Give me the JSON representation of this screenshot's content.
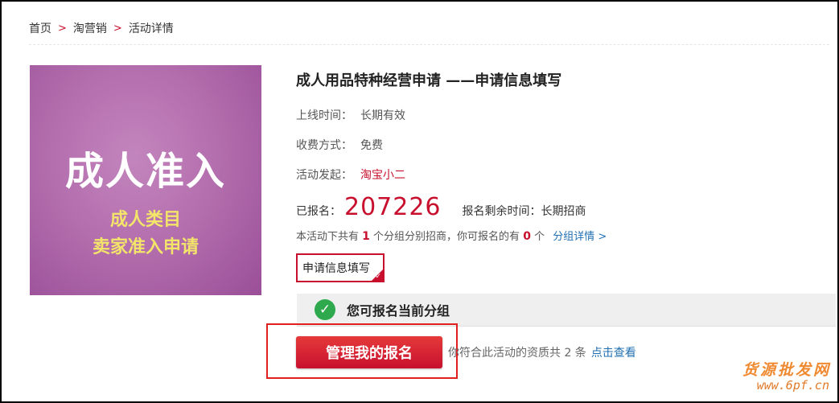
{
  "breadcrumb": {
    "items": [
      "首页",
      "淘营销",
      "活动详情"
    ],
    "separator": ">"
  },
  "poster": {
    "headline": "成人准入",
    "line1": "成人类目",
    "line2": "卖家准入申请"
  },
  "activity": {
    "title": "成人用品特种经营申请 ——申请信息填写",
    "online_label": "上线时间：",
    "online_value": "长期有效",
    "fee_label": "收费方式：",
    "fee_value": "免费",
    "initiator_label": "活动发起：",
    "initiator_value": "淘宝小二",
    "signup_label": "已报名：",
    "signup_count": "207226",
    "remaining_label": "报名剩余时间：",
    "remaining_value": "长期招商",
    "groups_text_1": "本活动下共有",
    "groups_total": "1",
    "groups_text_2": "个分组分别招商，你可报名的有",
    "groups_available": "0",
    "groups_text_3": "个",
    "groups_link": "分组详情 >"
  },
  "tab": {
    "label": "申请信息填写"
  },
  "status": {
    "text": "您可报名当前分组",
    "icon": "check-circle-icon"
  },
  "actions": {
    "manage_button": "管理我的报名",
    "qualification_text": "你符合此活动的资质共 2 条",
    "qualification_link": "点击查看"
  },
  "watermark": {
    "line1": "货源批发网",
    "line2": "www.6pf.cn"
  },
  "colors": {
    "accent_red": "#c8102e",
    "link_blue": "#1f6fb2",
    "success_green": "#2fa94e",
    "poster_purple": "#b46fae",
    "poster_yellow": "#f3e46a"
  }
}
